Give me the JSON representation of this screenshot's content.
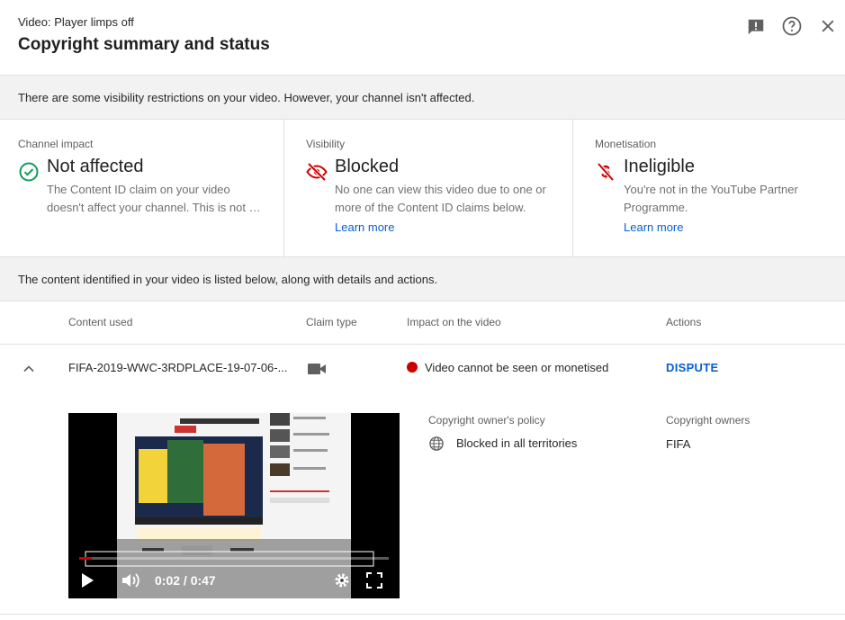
{
  "header": {
    "subtitle": "Video: Player limps off",
    "title": "Copyright summary and status"
  },
  "banner_top": "There are some visibility restrictions on your video. However, your channel isn't affected.",
  "cards": {
    "channel": {
      "label": "Channel impact",
      "value": "Not affected",
      "desc1": "The Content ID claim on your video",
      "desc2": "doesn't affect your channel. This is not …",
      "icon": "check-circle-icon",
      "color": "#0f9d58"
    },
    "visibility": {
      "label": "Visibility",
      "value": "Blocked",
      "desc1": "No one can view this video due to one or",
      "desc2": "more of the Content ID claims below.",
      "link": "Learn more",
      "icon": "eye-off-icon",
      "color": "#cc0000"
    },
    "monetisation": {
      "label": "Monetisation",
      "value": "Ineligible",
      "desc1": "You're not in the YouTube Partner",
      "desc2": "Programme.",
      "link": "Learn more",
      "icon": "money-off-icon",
      "color": "#cc0000"
    }
  },
  "banner_mid": "The content identified in your video is listed below, along with details and actions.",
  "table": {
    "headers": [
      "Content used",
      "Claim type",
      "Impact on the video",
      "Actions"
    ],
    "row": {
      "content": "FIFA-2019-WWC-3RDPLACE-19-07-06-...",
      "claim_icon": "video-camera-icon",
      "impact": "Video cannot be seen or monetised",
      "impact_color": "#cc0000",
      "action": "DISPUTE"
    }
  },
  "details": {
    "policy_label": "Copyright owner's policy",
    "policy_value": "Blocked in all territories",
    "owners_label": "Copyright owners",
    "owners_value": "FIFA"
  },
  "player": {
    "time": "0:02 / 0:47",
    "progress": 0.04
  },
  "colors": {
    "link": "#065fd4",
    "banner_bg": "#f2f2f2"
  }
}
